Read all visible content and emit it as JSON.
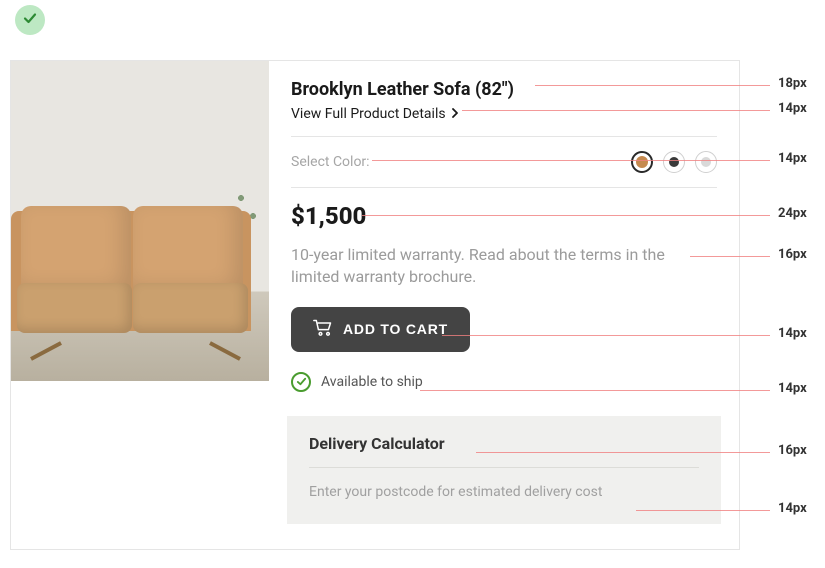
{
  "product": {
    "title": "Brooklyn Leather Sofa (82\")",
    "details_link": "View Full Product Details",
    "color_label": "Select Color:",
    "swatches": [
      {
        "name": "tan",
        "hex": "#c58a4f",
        "selected": true
      },
      {
        "name": "charcoal",
        "hex": "#3a3a3a",
        "selected": false
      },
      {
        "name": "light-grey",
        "hex": "#d9d9d9",
        "selected": false
      }
    ],
    "price": "$1,500",
    "warranty_text": "10-year limited warranty. Read about the terms in the limited warranty brochure.",
    "add_to_cart_label": "ADD TO CART",
    "availability_text": "Available to ship",
    "delivery": {
      "title": "Delivery Calculator",
      "hint": "Enter your postcode for estimated delivery cost"
    }
  },
  "annotations": [
    {
      "label": "18px",
      "target": "title"
    },
    {
      "label": "14px",
      "target": "details-link"
    },
    {
      "label": "14px",
      "target": "color-row"
    },
    {
      "label": "24px",
      "target": "price"
    },
    {
      "label": "16px",
      "target": "warranty"
    },
    {
      "label": "14px",
      "target": "add-to-cart"
    },
    {
      "label": "14px",
      "target": "availability"
    },
    {
      "label": "16px",
      "target": "delivery-title"
    },
    {
      "label": "14px",
      "target": "delivery-hint"
    }
  ]
}
